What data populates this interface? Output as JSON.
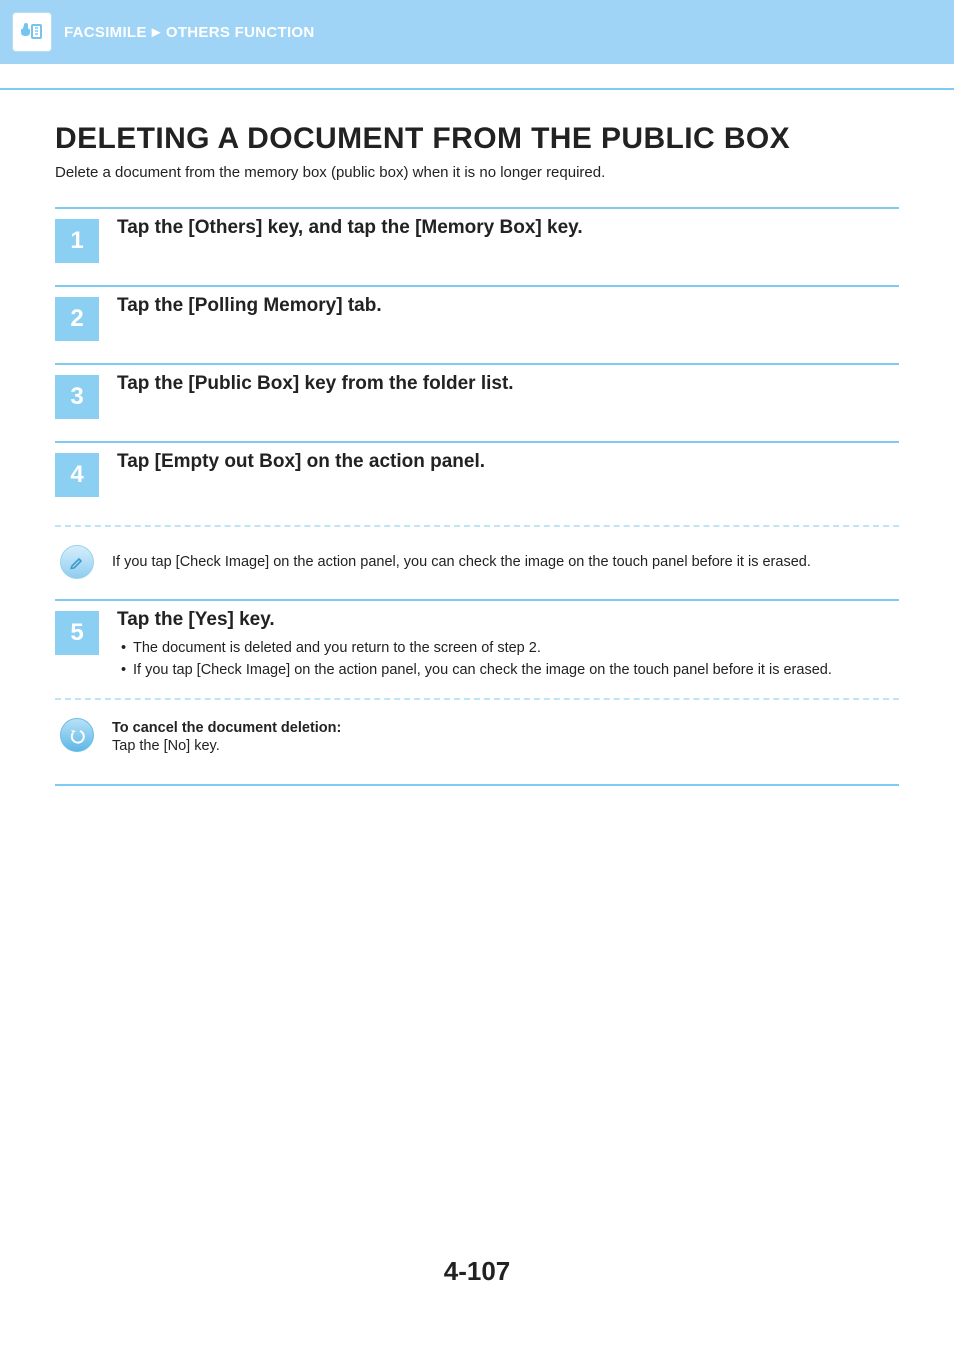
{
  "header": {
    "breadcrumb_left": "FACSIMILE",
    "sep": "►",
    "breadcrumb_right": "OTHERS FUNCTION",
    "icon_name": "fax-icon"
  },
  "title": "DELETING A DOCUMENT FROM THE PUBLIC BOX",
  "intro": "Delete a document from the memory box (public box) when it is no longer required.",
  "steps": [
    {
      "num": "1",
      "title": "Tap the [Others] key, and tap the [Memory Box] key.",
      "bullets": []
    },
    {
      "num": "2",
      "title": "Tap the [Polling Memory] tab.",
      "bullets": []
    },
    {
      "num": "3",
      "title": "Tap the [Public Box] key from the folder list.",
      "bullets": []
    },
    {
      "num": "4",
      "title": "Tap [Empty out Box] on the action panel.",
      "bullets": []
    }
  ],
  "note_info": "If you tap [Check Image] on the action panel, you can check the image on the touch panel before it is erased.",
  "step5": {
    "num": "5",
    "title": "Tap the [Yes] key.",
    "bullets": [
      "The document is deleted and you return to the screen of step 2.",
      "If you tap [Check Image] on the action panel, you can check the image on the touch panel before it is erased."
    ]
  },
  "cancel": {
    "title": "To cancel the document deletion:",
    "text": "Tap the [No] key."
  },
  "page_number": "4-107"
}
